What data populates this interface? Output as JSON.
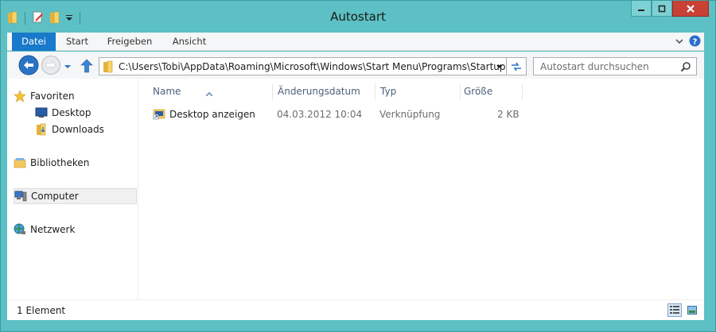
{
  "window": {
    "title": "Autostart"
  },
  "ribbon": {
    "tabs": [
      {
        "label": "Datei"
      },
      {
        "label": "Start"
      },
      {
        "label": "Freigeben"
      },
      {
        "label": "Ansicht"
      }
    ]
  },
  "address": {
    "path": "C:\\Users\\Tobi\\AppData\\Roaming\\Microsoft\\Windows\\Start Menu\\Programs\\Startup"
  },
  "search": {
    "placeholder": "Autostart durchsuchen"
  },
  "navpane": {
    "favorites": "Favoriten",
    "desktop": "Desktop",
    "downloads": "Downloads",
    "libraries": "Bibliotheken",
    "computer": "Computer",
    "network": "Netzwerk"
  },
  "columns": {
    "name": "Name",
    "date": "Änderungsdatum",
    "type": "Typ",
    "size": "Größe"
  },
  "files": [
    {
      "name": "Desktop anzeigen",
      "date": "04.03.2012 10:04",
      "type": "Verknüpfung",
      "size": "2 KB"
    }
  ],
  "status": {
    "count": "1 Element"
  },
  "colors": {
    "accent": "#1979ca",
    "frame": "#5cc0c4",
    "close": "#c94035"
  }
}
